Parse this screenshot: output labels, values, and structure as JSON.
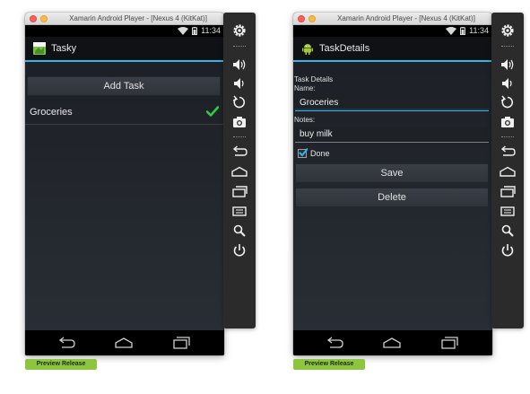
{
  "window_title": "Xamarin Android Player - [Nexus 4 (KitKat)]",
  "status_time": "11:34",
  "preview_badge": "Preview Release",
  "colors": {
    "accent": "#33b5e5",
    "check": "#2ecc40",
    "badge": "#8cc63f"
  },
  "left": {
    "app_title": "Tasky",
    "add_task_label": "Add Task",
    "tasks": [
      {
        "name": "Groceries",
        "done": true
      }
    ]
  },
  "right": {
    "app_title": "TaskDetails",
    "section_label": "Task Details",
    "name_label": "Name:",
    "name_value": "Groceries",
    "notes_label": "Notes:",
    "notes_value": "buy milk",
    "done_label": "Done",
    "done_checked": true,
    "save_label": "Save",
    "delete_label": "Delete"
  },
  "sidebar_icons": [
    "settings-icon",
    "volume-up-icon",
    "volume-down-icon",
    "rotate-icon",
    "camera-icon",
    "back-icon",
    "home-icon",
    "recent-apps-icon",
    "menu-icon",
    "search-icon",
    "power-icon"
  ],
  "nav_icons": [
    "back-icon",
    "home-icon",
    "recent-apps-icon"
  ]
}
